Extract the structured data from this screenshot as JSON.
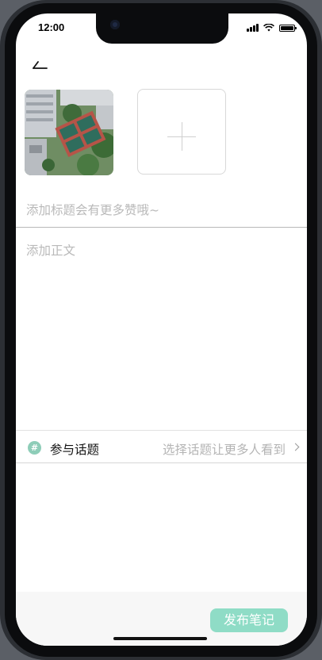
{
  "status_bar": {
    "time": "12:00",
    "icons": [
      "signal-icon",
      "wifi-icon",
      "battery-icon"
    ]
  },
  "header": {
    "back_icon": "back-arrow-icon"
  },
  "media": {
    "photo_desc": "aerial-campus-photo",
    "add_icon": "plus-icon"
  },
  "editor": {
    "title_placeholder": "添加标题会有更多赞哦~",
    "body_placeholder": "添加正文"
  },
  "topic": {
    "icon_glyph": "#",
    "label": "参与话题",
    "hint": "选择话题让更多人看到"
  },
  "footer": {
    "publish_label": "发布笔记"
  },
  "colors": {
    "accent": "#8fdcc6",
    "topic_icon": "#8ecdb8",
    "placeholder": "#b9b9b9"
  }
}
